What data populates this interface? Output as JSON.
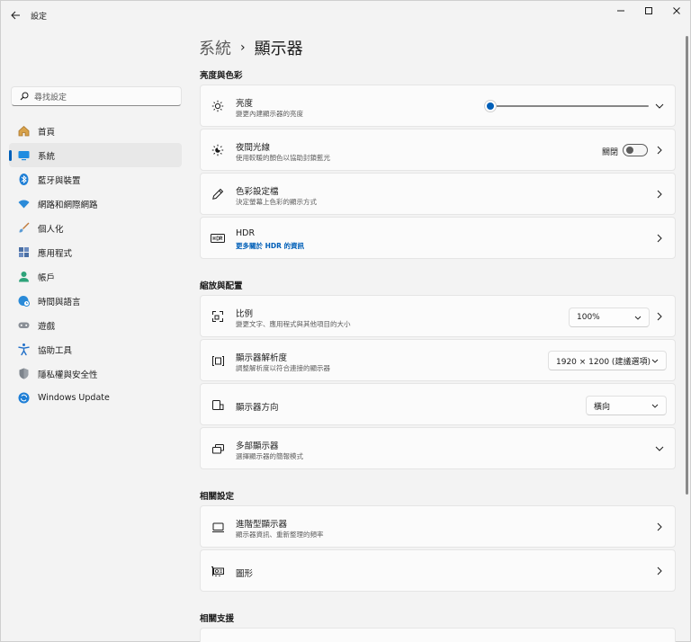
{
  "window": {
    "app_title": "設定"
  },
  "sidebar": {
    "search_placeholder": "尋找設定",
    "items": [
      {
        "label": "首頁",
        "icon": "home-icon"
      },
      {
        "label": "系統",
        "icon": "system-icon",
        "selected": true
      },
      {
        "label": "藍牙與裝置",
        "icon": "bluetooth-icon"
      },
      {
        "label": "網路和網際網路",
        "icon": "wifi-icon"
      },
      {
        "label": "個人化",
        "icon": "brush-icon"
      },
      {
        "label": "應用程式",
        "icon": "apps-icon"
      },
      {
        "label": "帳戶",
        "icon": "account-icon"
      },
      {
        "label": "時間與語言",
        "icon": "globe-clock-icon"
      },
      {
        "label": "遊戲",
        "icon": "gamepad-icon"
      },
      {
        "label": "協助工具",
        "icon": "accessibility-icon"
      },
      {
        "label": "隱私權與安全性",
        "icon": "shield-icon"
      },
      {
        "label": "Windows Update",
        "icon": "update-icon"
      }
    ]
  },
  "main": {
    "breadcrumb": {
      "parent": "系統",
      "separator": "›",
      "current": "顯示器"
    },
    "sections": {
      "brightness_color": "亮度與色彩",
      "scale_layout": "縮放與配置",
      "related_settings": "相關設定",
      "related_support": "相關支援"
    },
    "brightness": {
      "title": "亮度",
      "subtitle": "變更內建顯示器的亮度",
      "value_percent": 0
    },
    "night_light": {
      "title": "夜間光線",
      "subtitle": "使用較暖的顏色以協助封鎖藍光",
      "state": "關閉"
    },
    "color_profile": {
      "title": "色彩設定檔",
      "subtitle": "決定螢幕上色彩的顯示方式"
    },
    "hdr": {
      "title": "HDR",
      "link": "更多關於 HDR 的資訊"
    },
    "scale": {
      "title": "比例",
      "subtitle": "變更文字、應用程式與其他項目的大小",
      "value": "100%"
    },
    "resolution": {
      "title": "顯示器解析度",
      "subtitle": "調整解析度以符合連接的顯示器",
      "value": "1920 × 1200 (建議選項)"
    },
    "orientation": {
      "title": "顯示器方向",
      "value": "橫向"
    },
    "multiple_displays": {
      "title": "多部顯示器",
      "subtitle": "選擇顯示器的簡報模式"
    },
    "advanced_display": {
      "title": "進階型顯示器",
      "subtitle": "顯示器資訊、重新整理的頻率"
    },
    "graphics": {
      "title": "圖形"
    }
  },
  "colors": {
    "accent": "#005fb8",
    "background": "#f3f3f3",
    "card": "#fbfbfb"
  }
}
